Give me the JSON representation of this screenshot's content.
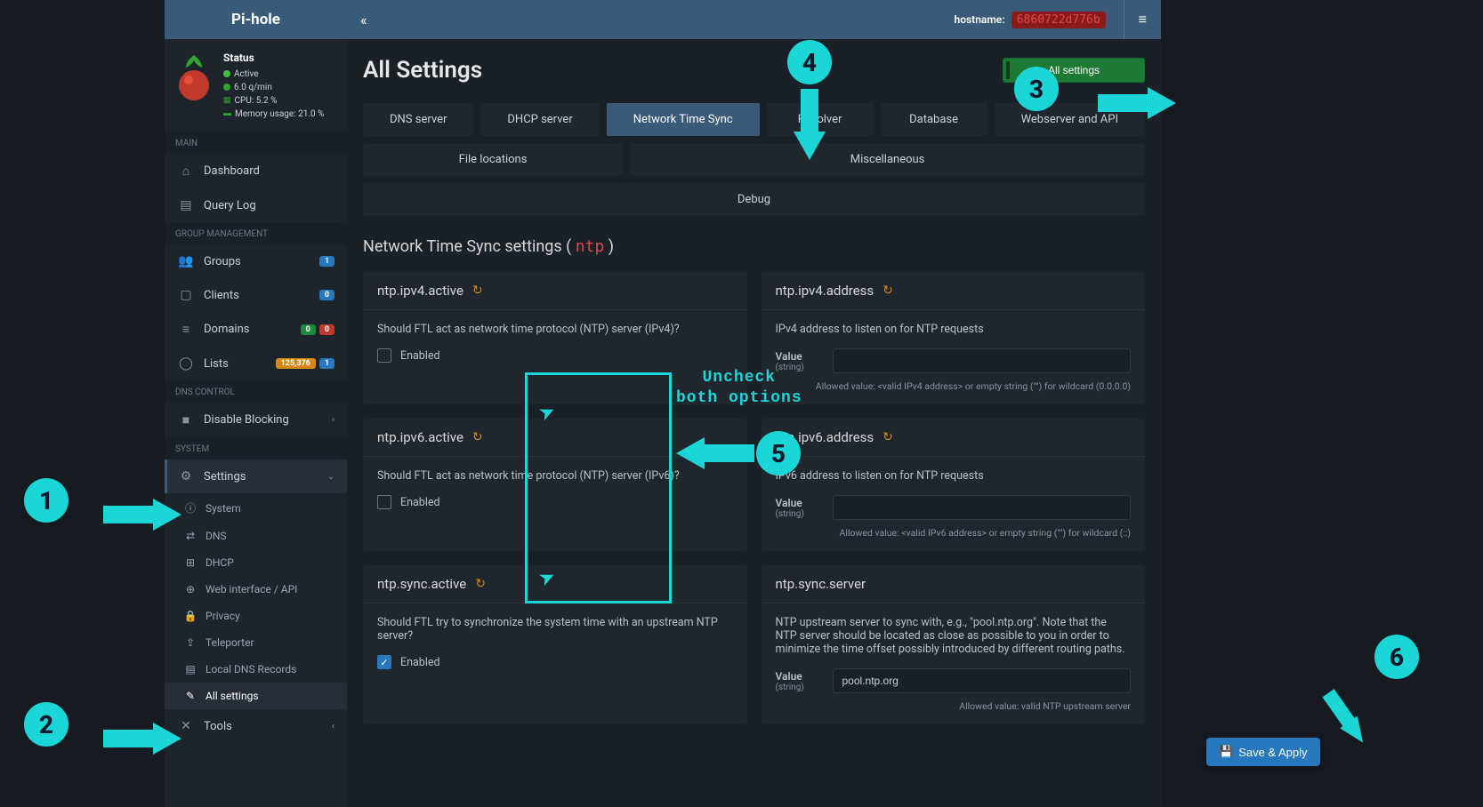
{
  "brand": "Pi-hole",
  "hostname_label": "hostname:",
  "hostname_value": "6860722d776b",
  "status": {
    "title": "Status",
    "active": "Active",
    "qpm": "6.0 q/min",
    "cpu": "CPU: 5.2 %",
    "mem": "Memory usage: 21.0 %"
  },
  "sections": {
    "main": "MAIN",
    "group": "GROUP MANAGEMENT",
    "dns": "DNS CONTROL",
    "system": "SYSTEM"
  },
  "nav": {
    "dashboard": "Dashboard",
    "querylog": "Query Log",
    "groups": "Groups",
    "groups_badge": "1",
    "clients": "Clients",
    "clients_badge": "0",
    "domains": "Domains",
    "domains_badge_a": "0",
    "domains_badge_b": "0",
    "lists": "Lists",
    "lists_badge_a": "125,376",
    "lists_badge_b": "1",
    "disable": "Disable Blocking",
    "settings": "Settings",
    "tools": "Tools"
  },
  "subnav": {
    "system": "System",
    "dns": "DNS",
    "dhcp": "DHCP",
    "web": "Web interface / API",
    "privacy": "Privacy",
    "teleporter": "Teleporter",
    "localdns": "Local DNS Records",
    "allsettings": "All settings"
  },
  "page": {
    "title": "All Settings",
    "all_settings_btn": "All settings"
  },
  "tabs": {
    "dns": "DNS server",
    "dhcp": "DHCP server",
    "ntp": "Network Time Sync",
    "resolver": "Resolver",
    "database": "Database",
    "webserver": "Webserver and API",
    "files": "File locations",
    "misc": "Miscellaneous",
    "debug": "Debug"
  },
  "section_heading_pre": "Network Time Sync settings ( ",
  "section_heading_key": "ntp",
  "section_heading_post": " )",
  "cards": {
    "ipv4active": {
      "title": "ntp.ipv4.active",
      "desc": "Should FTL act as network time protocol (NTP) server (IPv4)?",
      "check_label": "Enabled"
    },
    "ipv4addr": {
      "title": "ntp.ipv4.address",
      "desc": "IPv4 address to listen on for NTP requests",
      "value_label": "Value",
      "value_type": "(string)",
      "allowed": "Allowed value: <valid IPv4 address> or empty string (\"\") for wildcard (0.0.0.0)"
    },
    "ipv6active": {
      "title": "ntp.ipv6.active",
      "desc": "Should FTL act as network time protocol (NTP) server (IPv6)?",
      "check_label": "Enabled"
    },
    "ipv6addr": {
      "title": "ntp.ipv6.address",
      "desc": "IPv6 address to listen on for NTP requests",
      "value_label": "Value",
      "value_type": "(string)",
      "allowed": "Allowed value: <valid IPv6 address> or empty string (\"\") for wildcard (::)"
    },
    "syncactive": {
      "title": "ntp.sync.active",
      "desc": "Should FTL try to synchronize the system time with an upstream NTP server?",
      "check_label": "Enabled"
    },
    "syncserver": {
      "title": "ntp.sync.server",
      "desc": "NTP upstream server to sync with, e.g., \"pool.ntp.org\". Note that the NTP server should be located as close as possible to you in order to minimize the time offset possibly introduced by different routing paths.",
      "value_label": "Value",
      "value_type": "(string)",
      "value": "pool.ntp.org",
      "allowed": "Allowed value: valid NTP upstream server"
    }
  },
  "save_apply": "Save & Apply",
  "annotations": {
    "uncheck": "Uncheck\nboth options"
  }
}
